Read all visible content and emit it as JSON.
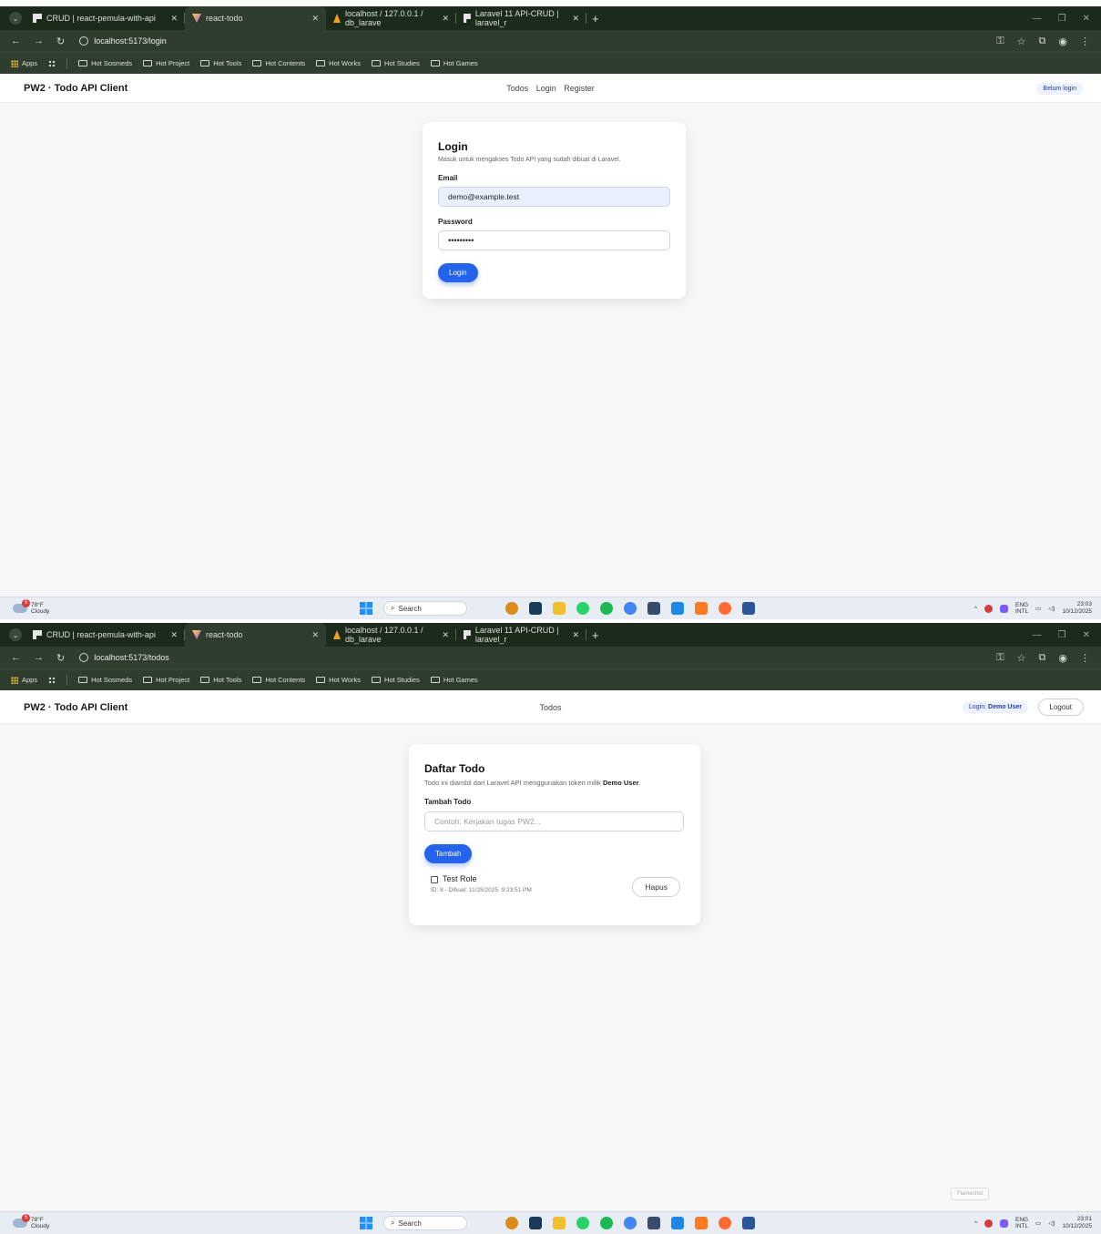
{
  "browser": {
    "tabs": [
      {
        "title": "CRUD | react-pemula-with-api",
        "icon": "crud-icon"
      },
      {
        "title": "react-todo",
        "icon": "react-icon",
        "active": true
      },
      {
        "title": "localhost / 127.0.0.1 / db_larave",
        "icon": "phpmyadmin-icon"
      },
      {
        "title": "Laravel 11 API-CRUD | laravel_r",
        "icon": "crud-icon"
      }
    ],
    "bookmarks": [
      "Apps",
      "Hot Sosmeds",
      "Hot Project",
      "Hot Tools",
      "Hot Contents",
      "Hot Works",
      "Hot Studies",
      "Hot Games"
    ]
  },
  "app": {
    "brand": "PW2 · Todo API Client"
  },
  "screen1": {
    "url": "localhost:5173/login",
    "nav": [
      "Todos",
      "Login",
      "Register"
    ],
    "status_pill": "Belum login",
    "login": {
      "title": "Login",
      "subtitle": "Masuk untuk mengakses Todo API yang sudah dibuat di Laravel.",
      "email_label": "Email",
      "email_value": "demo@example.test",
      "password_label": "Password",
      "password_value": "•••••••••",
      "button": "Login"
    },
    "clock": {
      "time": "23:03",
      "date": "10/12/2025"
    }
  },
  "screen2": {
    "url": "localhost:5173/todos",
    "nav": [
      "Todos"
    ],
    "status_pill_prefix": "Login:",
    "status_pill_user": "Demo User",
    "logout": "Logout",
    "todos": {
      "title": "Daftar Todo",
      "subtitle_prefix": "Todo ini diambil dari Laravel API menggunakan token milik",
      "subtitle_user": "Demo User",
      "subtitle_suffix": ".",
      "add_label": "Tambah Todo",
      "placeholder": "Contoh: Kerjakan tugas PW2...",
      "add_button": "Tambah",
      "items": [
        {
          "title": "Test Role",
          "meta": "ID: 8 - Dibuat: 11/28/2025, 9:23:51 PM",
          "done": false,
          "delete": "Hapus"
        }
      ]
    },
    "flameshot": "Flameshot",
    "clock": {
      "time": "23:01",
      "date": "10/12/2025"
    }
  },
  "taskbar": {
    "weather_temp": "78°F",
    "weather_desc": "Cloudy",
    "weather_badge": "5",
    "search": "Search",
    "lang_top": "ENG",
    "lang_bottom": "INTL"
  },
  "colors": {
    "accent": "#2563eb",
    "chrome": "#2f3d2f",
    "pill_text": "#1d3c9a"
  }
}
